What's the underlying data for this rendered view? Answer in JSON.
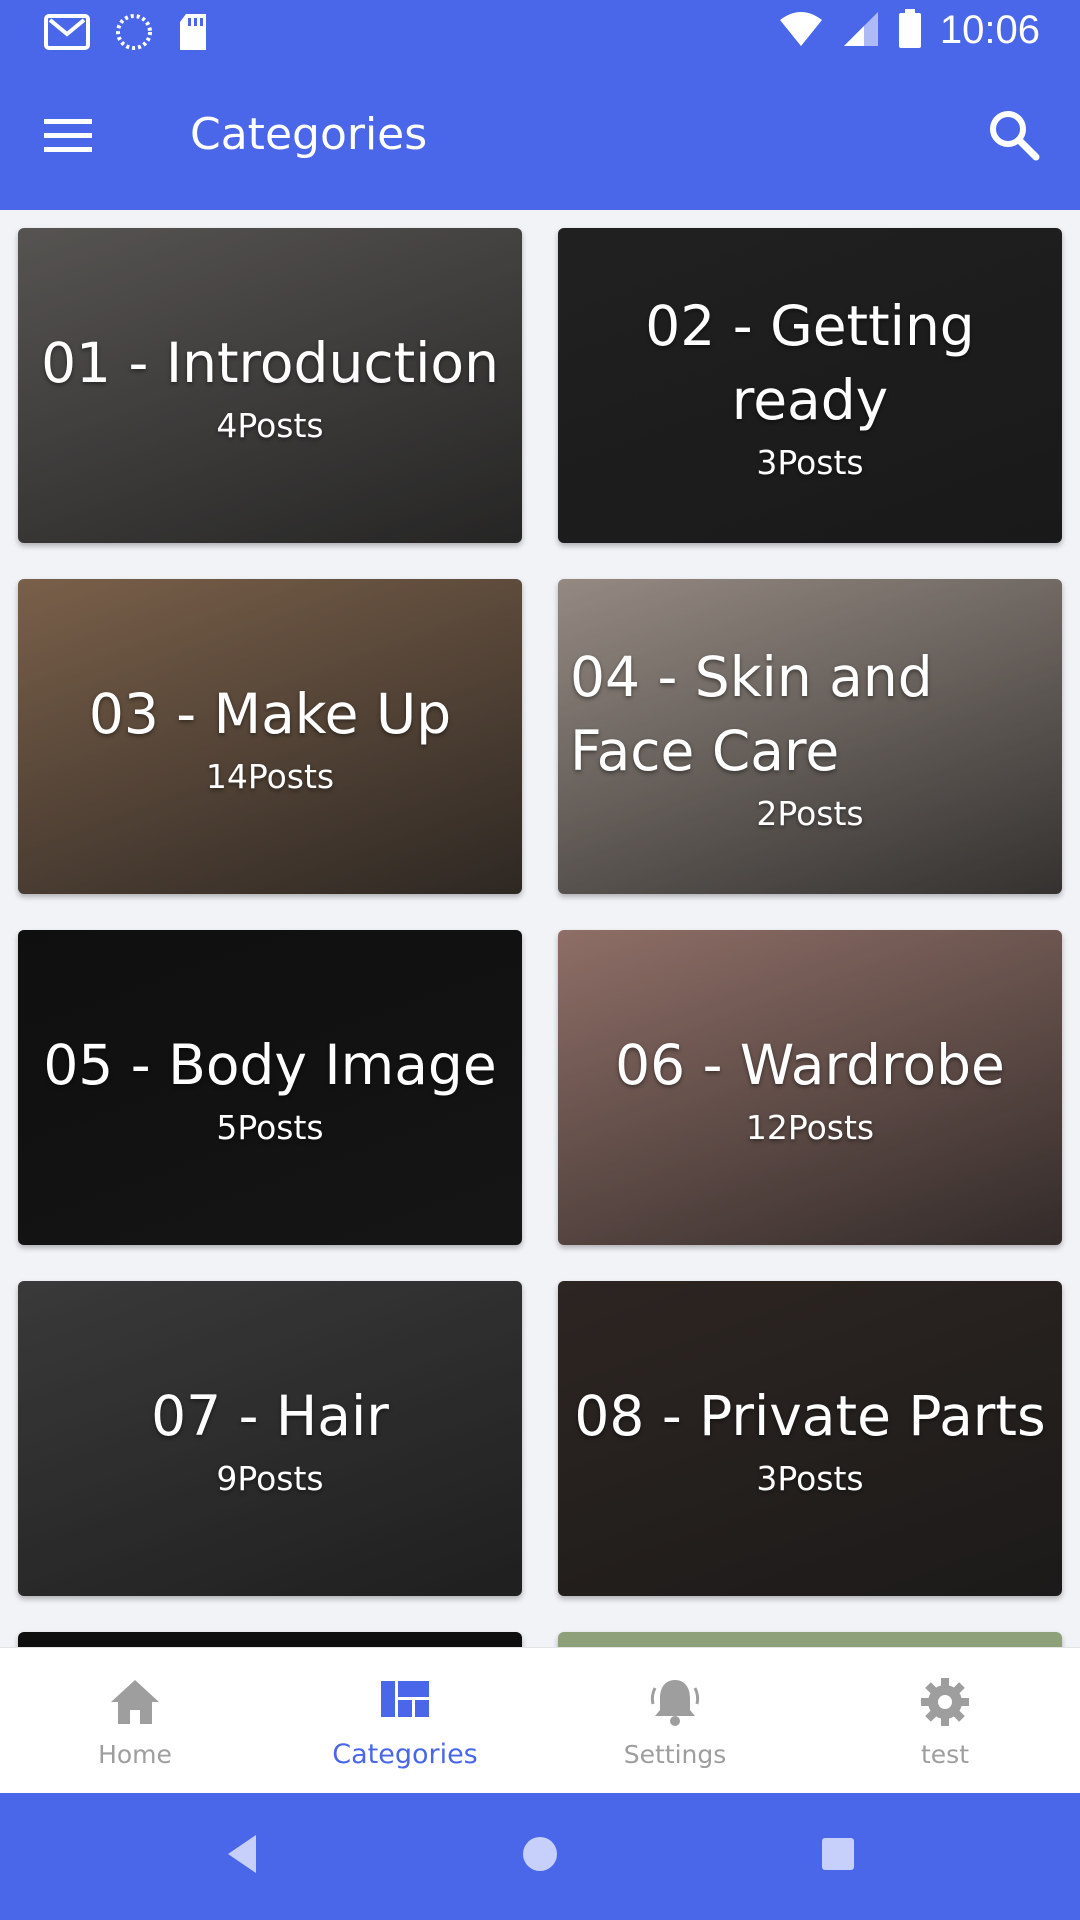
{
  "status_bar": {
    "time": "10:06",
    "left_icons": [
      "gmail-icon",
      "sync-icon",
      "sd-card-icon"
    ],
    "right_icons": [
      "wifi-icon",
      "signal-icon",
      "battery-icon"
    ]
  },
  "app_bar": {
    "title": "Categories",
    "menu_icon": "menu-icon",
    "search_icon": "search-icon"
  },
  "categories": [
    {
      "title": "01 - Introduction",
      "count": "4Posts",
      "bg": "#6f6c69"
    },
    {
      "title": "02 - Getting ready",
      "count": "3Posts",
      "bg": "#2a2a2a"
    },
    {
      "title": "03 - Make Up",
      "count": "14Posts",
      "bg": "#9c7b5f"
    },
    {
      "title": "04 - Skin and Face Care",
      "count": "2Posts",
      "bg": "#bfb1a7"
    },
    {
      "title": "05 - Body Image",
      "count": "5Posts",
      "bg": "#141414"
    },
    {
      "title": "06 - Wardrobe",
      "count": "12Posts",
      "bg": "#b78e84"
    },
    {
      "title": "07 - Hair",
      "count": "9Posts",
      "bg": "#4a4a4a"
    },
    {
      "title": "08 - Private Parts",
      "count": "3Posts",
      "bg": "#3a302c"
    }
  ],
  "bottom_nav": [
    {
      "label": "Home",
      "icon": "home-icon",
      "active": false
    },
    {
      "label": "Categories",
      "icon": "categories-icon",
      "active": true
    },
    {
      "label": "Settings",
      "icon": "bell-icon",
      "active": false
    },
    {
      "label": "test",
      "icon": "gear-icon",
      "active": false
    }
  ],
  "colors": {
    "primary": "#4a67ea",
    "inactive": "#9e9e9e",
    "background": "#f2f3f7"
  }
}
